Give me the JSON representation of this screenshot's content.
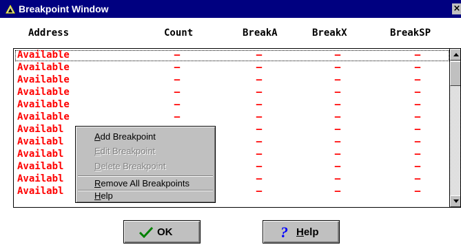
{
  "window": {
    "title": "Breakpoint Window",
    "close_glyph": "×"
  },
  "columns": [
    "Address",
    "Count",
    "BreakA",
    "BreakX",
    "BreakSP"
  ],
  "rows": [
    {
      "address": "Available",
      "count": "–",
      "breaka": "–",
      "breakx": "–",
      "breaksp": "–"
    },
    {
      "address": "Available",
      "count": "–",
      "breaka": "–",
      "breakx": "–",
      "breaksp": "–"
    },
    {
      "address": "Available",
      "count": "–",
      "breaka": "–",
      "breakx": "–",
      "breaksp": "–"
    },
    {
      "address": "Available",
      "count": "–",
      "breaka": "–",
      "breakx": "–",
      "breaksp": "–"
    },
    {
      "address": "Available",
      "count": "–",
      "breaka": "–",
      "breakx": "–",
      "breaksp": "–"
    },
    {
      "address": "Available",
      "count": "–",
      "breaka": "–",
      "breakx": "–",
      "breaksp": "–"
    },
    {
      "address": "Availabl",
      "count": "–",
      "breaka": "–",
      "breakx": "–",
      "breaksp": "–"
    },
    {
      "address": "Availabl",
      "count": "–",
      "breaka": "–",
      "breakx": "–",
      "breaksp": "–"
    },
    {
      "address": "Availabl",
      "count": "–",
      "breaka": "–",
      "breakx": "–",
      "breaksp": "–"
    },
    {
      "address": "Availabl",
      "count": "–",
      "breaka": "–",
      "breakx": "–",
      "breaksp": "–"
    },
    {
      "address": "Availabl",
      "count": "–",
      "breaka": "–",
      "breakx": "–",
      "breaksp": "–"
    },
    {
      "address": "Availabl",
      "count": "–",
      "breaka": "–",
      "breakx": "–",
      "breaksp": "–"
    }
  ],
  "context_menu": {
    "add_prefix": "A",
    "add_rest": "dd Breakpoint",
    "edit_prefix": "E",
    "edit_rest": "dit Breakpoint",
    "delete_prefix": "D",
    "delete_rest": "elete Breakpoint",
    "remove_prefix": "R",
    "remove_rest": "emove All Breakpoints",
    "help_prefix": "H",
    "help_rest": "elp"
  },
  "buttons": {
    "ok_label": "OK",
    "help_prefix": "H",
    "help_rest": "elp"
  },
  "icons": {
    "title": "window-app-icon",
    "ok": "checkmark-icon",
    "help": "question-mark-icon",
    "scroll_up": "arrow-up-icon",
    "scroll_down": "arrow-down-icon"
  },
  "colors": {
    "title_bar": "#000080",
    "available_text": "#ff0000",
    "face": "#c0c0c0",
    "ok_check": "#008000",
    "help_question": "#0000ff"
  }
}
